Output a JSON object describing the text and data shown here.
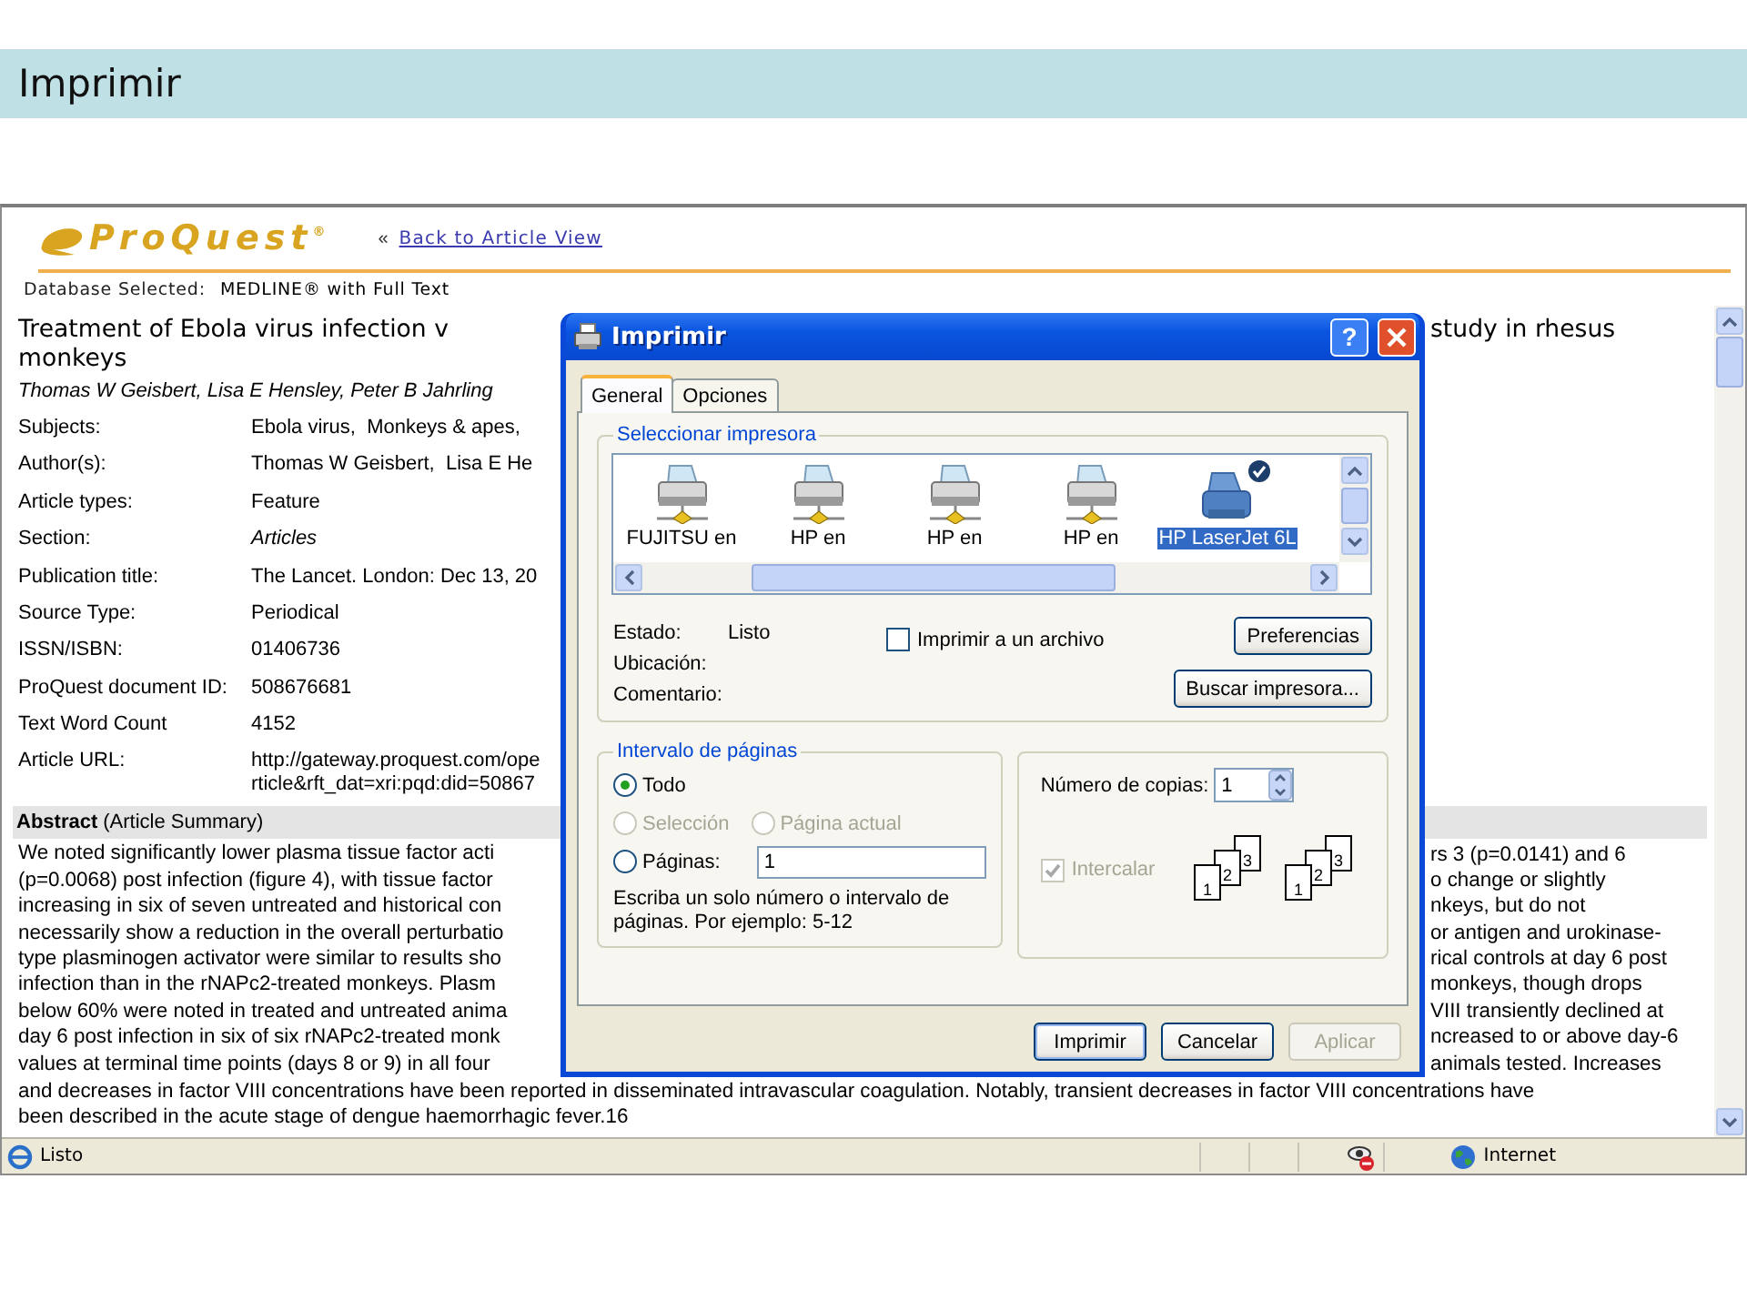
{
  "slide": {
    "title": "Imprimir"
  },
  "browser": {
    "logo": "ProQuest$^{®}$",
    "back_marker": "«",
    "back_link": "Back to Article View",
    "database": {
      "label": "Database Selected:",
      "value": "MEDLINE® with Full Text"
    },
    "title_left": "Treatment of Ebola virus infection v",
    "title_left_2": "monkeys",
    "title_right": "study in rhesus",
    "authors": "Thomas W Geisbert, Lisa E Hensley, Peter B Jahrling",
    "fields": [
      {
        "label": "Subjects:",
        "lines": [
          "Ebola virus,  Monkeys & apes,"
        ],
        "italic": false
      },
      {
        "label": "Author(s):",
        "lines": [
          "Thomas W Geisbert,  Lisa E He"
        ],
        "italic": false
      },
      {
        "label": "Article types:",
        "lines": [
          "Feature"
        ],
        "italic": false
      },
      {
        "label": "Section:",
        "lines": [
          "Articles"
        ],
        "italic": true
      },
      {
        "label": "Publication title:",
        "lines": [
          "The Lancet. London: Dec 13, 20"
        ],
        "italic": false
      },
      {
        "label": "Source Type:",
        "lines": [
          "Periodical"
        ],
        "italic": false
      },
      {
        "label": "ISSN/ISBN:",
        "lines": [
          "01406736"
        ],
        "italic": false
      },
      {
        "label": "ProQuest document ID:",
        "lines": [
          "508676681"
        ],
        "italic": false
      },
      {
        "label": "Text Word Count",
        "lines": [
          "4152"
        ],
        "italic": false
      },
      {
        "label": "Article URL:",
        "lines": [
          "http://gateway.proquest.com/ope",
          "rticle&rft_dat=xri:pqd:did=50867"
        ],
        "italic": false
      }
    ],
    "abstract": {
      "heading": "Abstract",
      "subheading": "(Article Summary)",
      "lines_left": [
        "We noted significantly lower plasma tissue factor acti",
        "(p=0.0068) post infection (figure 4), with tissue factor",
        "increasing in six of seven untreated and historical con",
        "necessarily show a reduction in the overall perturbatio",
        "type plasminogen activator were similar to results sho",
        "infection than in the rNAPc2-treated monkeys. Plasm",
        "below 60% were noted in treated and untreated anima",
        "day 6 post infection in six of six rNAPc2-treated monk",
        "values at terminal time points (days 8 or 9) in all four"
      ],
      "lines_right": [
        "rs 3 (p=0.0141) and 6",
        "o change or slightly",
        "nkeys, but do not",
        "or antigen and urokinase-",
        "rical controls at day 6 post",
        "monkeys, though drops",
        "VIII transiently declined at",
        "ncreased to or above day-6",
        "animals tested. Increases"
      ],
      "lines_full": [
        "and decreases in factor VIII concentrations have been reported in disseminated intravascular coagulation. Notably, transient decreases in factor VIII concentrations have",
        "been described in the acute stage of dengue haemorrhagic fever.16"
      ]
    },
    "status_bar": {
      "text": "Listo",
      "zone": "Internet"
    }
  },
  "dialog": {
    "title": "Imprimir",
    "help": "?",
    "tabs": [
      {
        "label": "General",
        "selected": true
      },
      {
        "label": "Opciones",
        "selected": false
      }
    ],
    "printer_group": "Seleccionar impresora",
    "printers": [
      {
        "name": "FUJITSU en",
        "kind": "network",
        "selected": false,
        "default": false
      },
      {
        "name": "HP en",
        "kind": "network",
        "selected": false,
        "default": false
      },
      {
        "name": "HP en",
        "kind": "network",
        "selected": false,
        "default": false
      },
      {
        "name": "HP en",
        "kind": "network",
        "selected": false,
        "default": false
      },
      {
        "name": "HP LaserJet 6L",
        "kind": "local",
        "selected": true,
        "default": true
      }
    ],
    "info": [
      {
        "label": "Estado:",
        "value": "Listo"
      },
      {
        "label": "Ubicación:"
      },
      {
        "label": "Comentario:"
      }
    ],
    "print_to_file": {
      "label": "Imprimir a un archivo",
      "checked": false
    },
    "preferences_button": "Preferencias",
    "find_button": "Buscar impresora...",
    "range_group": "Intervalo de páginas",
    "ranges": [
      {
        "label": "Todo",
        "selected": true,
        "disabled": false
      },
      {
        "label": "Selección",
        "selected": false,
        "disabled": true
      },
      {
        "label": "Página actual",
        "selected": false,
        "disabled": true
      },
      {
        "label": "Páginas:",
        "selected": false,
        "disabled": false
      }
    ],
    "pages_value": "1",
    "range_hint": "Escriba un solo número o intervalo de páginas. Por ejemplo: 5-12",
    "copies": {
      "label": "Número de copias:",
      "value": "1"
    },
    "collate": {
      "label": "Intercalar",
      "checked": true,
      "disabled": true,
      "stacks": [
        [
          "1",
          "2",
          "3"
        ],
        [
          "1",
          "2",
          "3"
        ]
      ]
    },
    "buttons": [
      {
        "label": "Imprimir",
        "kind": "default"
      },
      {
        "label": "Cancelar",
        "kind": "normal"
      },
      {
        "label": "Aplicar",
        "kind": "disabled"
      }
    ]
  }
}
